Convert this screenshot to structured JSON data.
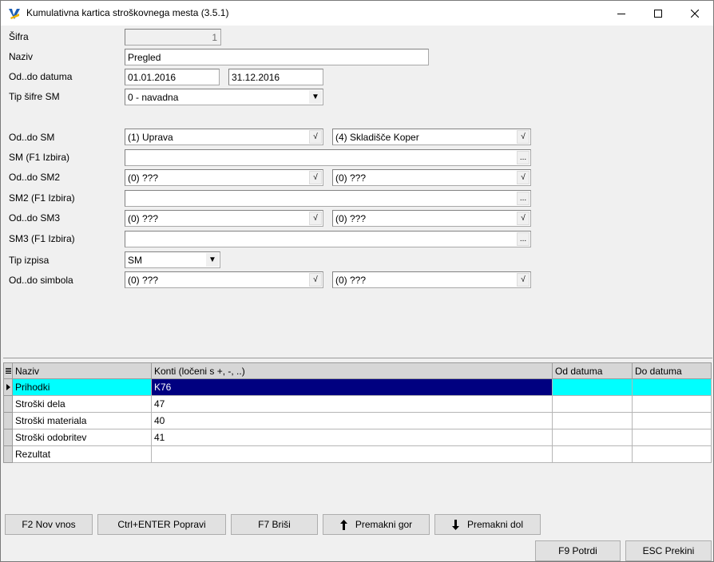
{
  "window": {
    "title": "Kumulativna kartica stroškovnega mesta  (3.5.1)",
    "controls": {
      "minimize": "–",
      "maximize": "□",
      "close": "✕"
    }
  },
  "form": {
    "sifra": {
      "label": "Šifra",
      "value": "1"
    },
    "naziv": {
      "label": "Naziv",
      "value": "Pregled"
    },
    "datum": {
      "label": "Od..do datuma",
      "from": "01.01.2016",
      "to": "31.12.2016"
    },
    "tip_sifre": {
      "label": "Tip šifre SM",
      "value": "0 - navadna"
    },
    "sm_range": {
      "label": "Od..do SM",
      "from": "(1) Uprava",
      "to": "(4) Skladišče Koper"
    },
    "sm_select": {
      "label": "SM (F1 Izbira)",
      "value": ""
    },
    "sm2_range": {
      "label": "Od..do SM2",
      "from": "(0) ???",
      "to": "(0) ???"
    },
    "sm2_select": {
      "label": "SM2 (F1 Izbira)",
      "value": ""
    },
    "sm3_range": {
      "label": "Od..do SM3",
      "from": "(0) ???",
      "to": "(0) ???"
    },
    "sm3_select": {
      "label": "SM3 (F1 Izbira)",
      "value": ""
    },
    "tip_izpisa": {
      "label": "Tip izpisa",
      "value": "SM"
    },
    "simbol_range": {
      "label": "Od..do simbola",
      "from": "(0) ???",
      "to": "(0) ???"
    },
    "check_glyph": "√",
    "ellipsis_glyph": "...",
    "dropdown_glyph": "▼"
  },
  "grid": {
    "columns": [
      "Naziv",
      "Konti (ločeni s +, -, ..)",
      "Od datuma",
      "Do datuma"
    ],
    "rows": [
      {
        "naziv": "Prihodki",
        "konti": "K76",
        "od": "",
        "do": ""
      },
      {
        "naziv": "Stroški dela",
        "konti": "47",
        "od": "",
        "do": ""
      },
      {
        "naziv": "Stroški materiala",
        "konti": "40",
        "od": "",
        "do": ""
      },
      {
        "naziv": "Stroški odobritev",
        "konti": "41",
        "od": "",
        "do": ""
      },
      {
        "naziv": "Rezultat",
        "konti": "",
        "od": "",
        "do": ""
      }
    ],
    "selected_row_marker": "▶"
  },
  "buttons": {
    "new": "F2 Nov vnos",
    "edit": "Ctrl+ENTER Popravi",
    "delete": "F7 Briši",
    "move_up": "Premakni gor",
    "move_down": "Premakni dol",
    "confirm": "F9 Potrdi",
    "cancel": "ESC Prekini"
  },
  "colors": {
    "selected_row": "#00ffff",
    "editing_cell": "#000080"
  }
}
